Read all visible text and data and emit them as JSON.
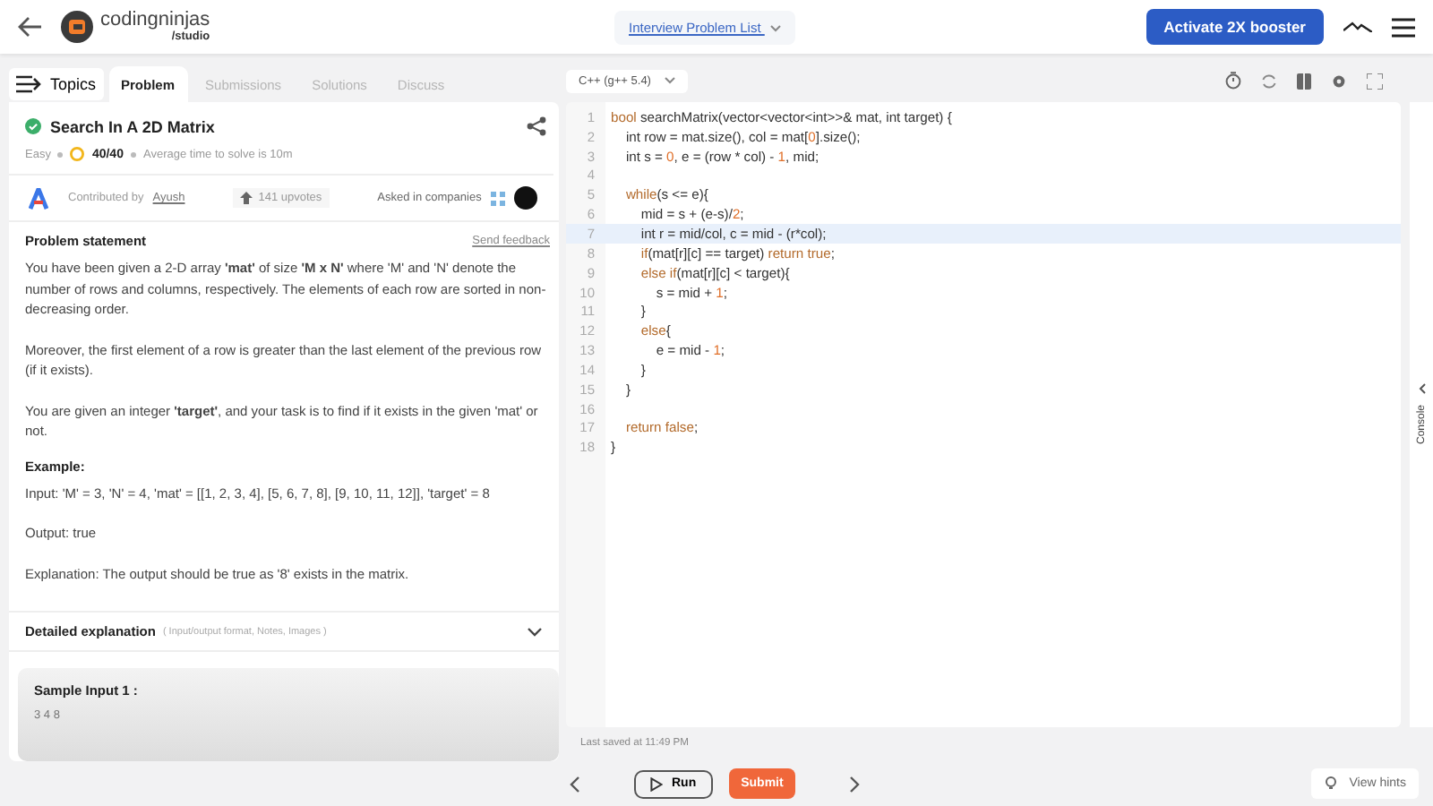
{
  "header": {
    "brand": "codingninjas",
    "brand_sub": "/studio",
    "problem_list": "Interview Problem List",
    "booster_button": "Activate 2X booster"
  },
  "tabs": [
    {
      "label": "Problem",
      "selected": true
    },
    {
      "label": "Submissions",
      "selected": false
    },
    {
      "label": "Solutions",
      "selected": false
    },
    {
      "label": "Discuss",
      "selected": false
    }
  ],
  "topics_button": "Topics",
  "problem": {
    "title": "Search In A 2D Matrix",
    "solved": true,
    "difficulty": "Easy",
    "score": "40/40",
    "avg_time": "Average time to solve is 10m",
    "contributed_by": "Contributed by",
    "contributor": "Ayush",
    "upvotes": "141 upvotes",
    "asked_in": "Asked in companies",
    "statement_heading": "Problem statement",
    "feedback_link": "Send feedback",
    "paragraphs": [
      "You have been given a 2-D array **'mat'** of size **'M x N'** where 'M' and 'N' denote the number of rows and columns, respectively. The elements of each row are sorted in non-decreasing order.",
      "Moreover, the first element of a row is greater than the last element of the previous row (if it exists).",
      "You are given an integer **'target'**, and your task is to find if it exists in the given 'mat' or not."
    ],
    "example_heading": "Example:",
    "example_lines": [
      "Input: 'M' = 3, 'N' = 4, 'mat' = [[1, 2, 3, 4], [5, 6, 7, 8], [9, 10, 11, 12]], 'target' = 8",
      "Output: true",
      "Explanation: The output should be true as '8' exists in the matrix."
    ],
    "detailed": {
      "heading": "Detailed explanation",
      "note": "( Input/output format, Notes, Images )",
      "expanded": false
    },
    "sample": {
      "heading": "Sample Input 1 :",
      "value": "3 4 8"
    }
  },
  "editor": {
    "language": "C++ (g++ 5.4)",
    "last_saved": "Last saved at 11:49 PM",
    "console": "Console",
    "lines": [
      {
        "number": "1",
        "current": false,
        "tokens": [
          {
            "kind": "kw",
            "t": "bool"
          },
          {
            "kind": "plain",
            "t": " searchMatrix(vector<vector<int>>& mat, int target) {"
          }
        ]
      },
      {
        "number": "2",
        "current": false,
        "tokens": [
          {
            "kind": "plain",
            "t": "    int row = mat.size(), col = mat["
          },
          {
            "kind": "num",
            "t": "0"
          },
          {
            "kind": "plain",
            "t": "].size();"
          }
        ]
      },
      {
        "number": "3",
        "current": false,
        "tokens": [
          {
            "kind": "plain",
            "t": "    int s = "
          },
          {
            "kind": "num",
            "t": "0"
          },
          {
            "kind": "plain",
            "t": ", e = (row * col) - "
          },
          {
            "kind": "num",
            "t": "1"
          },
          {
            "kind": "plain",
            "t": ", mid;"
          }
        ]
      },
      {
        "number": "4",
        "current": false
      },
      {
        "number": "5",
        "current": false,
        "tokens": [
          {
            "kind": "kw",
            "t": "    while"
          },
          {
            "kind": "plain",
            "t": "(s <= e){"
          }
        ]
      },
      {
        "number": "6",
        "current": false,
        "tokens": [
          {
            "kind": "plain",
            "t": "        mid = s + (e-s)/"
          },
          {
            "kind": "num",
            "t": "2"
          },
          {
            "kind": "plain",
            "t": ";"
          }
        ]
      },
      {
        "number": "7",
        "current": true,
        "tokens": [
          {
            "kind": "plain",
            "t": "        int r = mid/col, c = mid - (r*col);"
          }
        ]
      },
      {
        "number": "8",
        "current": false,
        "tokens": [
          {
            "kind": "kw",
            "t": "        if"
          },
          {
            "kind": "plain",
            "t": "(mat[r][c] == target) "
          },
          {
            "kind": "kw",
            "t": "return true"
          },
          {
            "kind": "plain",
            "t": ";"
          }
        ]
      },
      {
        "number": "9",
        "current": false,
        "tokens": [
          {
            "kind": "kw",
            "t": "        else if"
          },
          {
            "kind": "plain",
            "t": "(mat[r][c] < target){"
          }
        ]
      },
      {
        "number": "10",
        "current": false,
        "tokens": [
          {
            "kind": "plain",
            "t": "            s = mid + "
          },
          {
            "kind": "num",
            "t": "1"
          },
          {
            "kind": "plain",
            "t": ";"
          }
        ]
      },
      {
        "number": "11",
        "current": false,
        "tokens": [
          {
            "kind": "plain",
            "t": "        }"
          }
        ]
      },
      {
        "number": "12",
        "current": false,
        "tokens": [
          {
            "kind": "kw",
            "t": "        else"
          },
          {
            "kind": "plain",
            "t": "{"
          }
        ]
      },
      {
        "number": "13",
        "current": false,
        "tokens": [
          {
            "kind": "plain",
            "t": "            e = mid - "
          },
          {
            "kind": "num",
            "t": "1"
          },
          {
            "kind": "plain",
            "t": ";"
          }
        ]
      },
      {
        "number": "14",
        "current": false,
        "tokens": [
          {
            "kind": "plain",
            "t": "        }"
          }
        ]
      },
      {
        "number": "15",
        "current": false,
        "tokens": [
          {
            "kind": "plain",
            "t": "    }"
          }
        ]
      },
      {
        "number": "16",
        "current": false
      },
      {
        "number": "17",
        "current": false,
        "tokens": [
          {
            "kind": "kw",
            "t": "    return false"
          },
          {
            "kind": "plain",
            "t": ";"
          }
        ]
      },
      {
        "number": "18",
        "current": false,
        "tokens": [
          {
            "kind": "plain",
            "t": "}"
          }
        ]
      }
    ]
  },
  "footer": {
    "run_button": "Run",
    "submit_button": "Submit",
    "hints_button": "View hints"
  }
}
